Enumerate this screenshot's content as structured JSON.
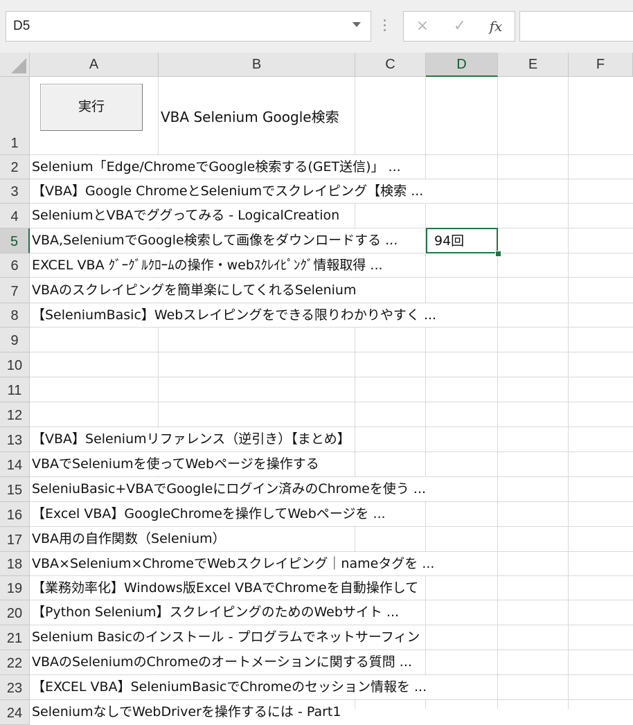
{
  "formula_bar": {
    "name_box": "D5",
    "formula": ""
  },
  "columns": [
    "A",
    "B",
    "C",
    "D",
    "E",
    "F"
  ],
  "selected_column": "D",
  "rows": [
    "1",
    "2",
    "3",
    "4",
    "5",
    "6",
    "7",
    "8",
    "9",
    "10",
    "11",
    "12",
    "13",
    "14",
    "15",
    "16",
    "17",
    "18",
    "19",
    "20",
    "21",
    "22",
    "23",
    "24"
  ],
  "selected_row": "5",
  "button": {
    "label": "実行"
  },
  "title": "VBA Selenium Google検索",
  "results": [
    "Selenium「Edge/ChromeでGoogle検索する(GET送信)」 ...",
    "【VBA】Google ChromeとSeleniumでスクレイピング【検索 ...",
    "SeleniumとVBAでググってみる - LogicalCreation",
    "VBA,SeleniumでGoogle検索して画像をダウンロードする ...",
    "EXCEL VBA ｸﾞｰｸﾞﾙｸﾛｰﾑの操作・webｽｸﾚｲﾋﾟﾝｸﾞ情報取得 ...",
    "VBAのスクレイピングを簡単楽にしてくれるSelenium",
    "【SeleniumBasic】Webスレイピングをできる限りわかりやすく ..."
  ],
  "active_cell_value": "94回",
  "results2": [
    "【VBA】Seleniumリファレンス（逆引き）【まとめ】",
    "VBAでSeleniumを使ってWebページを操作する",
    "SeleniuBasic+VBAでGoogleにログイン済みのChromeを使う ...",
    "【Excel VBA】GoogleChromeを操作してWebページを ...",
    "VBA用の自作関数（Selenium）",
    "VBA×Selenium×ChromeでWebスクレイピング｜nameタグを ...",
    "【業務効率化】Windows版Excel VBAでChromeを自動操作して",
    "【Python Selenium】スクレイピングのためのWebサイト ...",
    "Selenium Basicのインストール - プログラムでネットサーフィン",
    "VBAのSeleniumのChromeのオートメーションに関する質問 ...",
    "【EXCEL VBA】SeleniumBasicでChromeのセッション情報を ...",
    "SeleniumなしでWebDriverを操作するには - Part1"
  ],
  "icons": {
    "cancel": "×",
    "enter": "✓",
    "insert_function": "fx"
  }
}
